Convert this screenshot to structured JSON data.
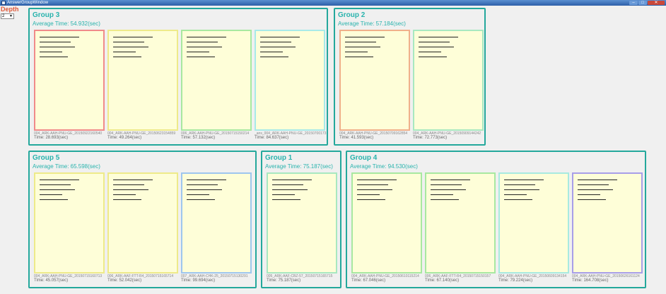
{
  "window": {
    "title": "AnswerGroupWindow"
  },
  "depth": {
    "label": "Depth",
    "value": "2"
  },
  "colors": {
    "accent": "#29b3ad",
    "border": "#24a89c",
    "depth_label": "#e05a3a",
    "card_bg": "#fefed8"
  },
  "groups": [
    {
      "title": "Group 3",
      "avg": "Average Time: 54.932(sec)",
      "cards": [
        {
          "id": "004_ARK-AAH-PNU-GE_20150922160540",
          "time": "Time: 28.693(sec)",
          "color": "#f08a8a"
        },
        {
          "id": "004_ARK-AAH-PNU-GE_20150623154859",
          "time": "Time: 49.264(sec)",
          "color": "#eeea8a"
        },
        {
          "id": "006_ARK-AAH-PNU-GE_20150715150214",
          "time": "Time: 57.132(sec)",
          "color": "#a8e8a0"
        },
        {
          "id": "_ans_004_ARK-AAH-PNU-GE_20150700173",
          "time": "Time: 84.637(sec)",
          "color": "#a8eae8"
        }
      ]
    },
    {
      "title": "Group 2",
      "avg": "Average Time: 57.184(sec)",
      "cards": [
        {
          "id": "004_ARK-AAH-PNU-GE_20150709162854",
          "time": "Time: 41.593(sec)",
          "color": "#f0b08a"
        },
        {
          "id": "004_ARK-AAH-PNU-GE_20150909144242",
          "time": "Time: 72.773(sec)",
          "color": "#a8e8c0"
        }
      ]
    },
    {
      "title": "Group 5",
      "avg": "Average Time: 65.598(sec)",
      "cards": [
        {
          "id": "004_ARK-AAH-PNU-GE_20150715160713",
          "time": "Time: 45.057(sec)",
          "color": "#eeea8a"
        },
        {
          "id": "006_ARK-AAF-FTT-R4_20150715165714",
          "time": "Time: 52.042(sec)",
          "color": "#eeea8a"
        },
        {
          "id": "007_ARK-AAH-CHK-25_20150715130291",
          "time": "Time: 99.694(sec)",
          "color": "#9ec6ee"
        }
      ]
    },
    {
      "title": "Group 1",
      "avg": "Average Time: 75.187(sec)",
      "cards": [
        {
          "id": "005_ARK-AAF-CBZ-57_20150715165715",
          "time": "Time: 75.187(sec)",
          "color": "#a8e8c0"
        }
      ]
    },
    {
      "title": "Group 4",
      "avg": "Average Time: 94.530(sec)",
      "cards": [
        {
          "id": "004_ARK-AAH-PNU-GE_20150610115214",
          "time": "Time: 67.046(sec)",
          "color": "#a8e8a0"
        },
        {
          "id": "006_ARK-AAF-FTT-R4_20150715150157",
          "time": "Time: 67.140(sec)",
          "color": "#a8e8a0"
        },
        {
          "id": "004_ARK-AAH-PNU-GE_20150609134154",
          "time": "Time: 79.224(sec)",
          "color": "#a8eae0"
        },
        {
          "id": "004_ARK-AAH-PNU-GE_20150626161124",
          "time": "Time: 164.708(sec)",
          "color": "#a89ee8"
        }
      ]
    }
  ]
}
